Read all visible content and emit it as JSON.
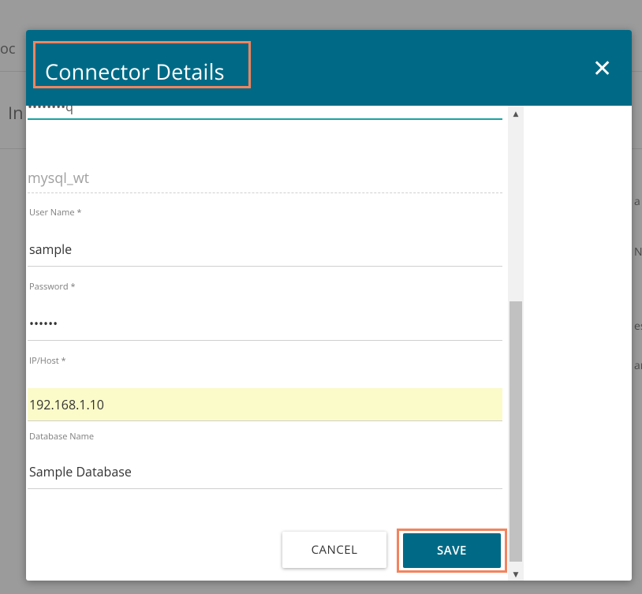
{
  "background": {
    "fragment_1": "oc",
    "fragment_2": "In",
    "fragment_3": "a",
    "fragment_4": "Na",
    "fragment_5": "es",
    "fragment_6": "an"
  },
  "modal": {
    "title": "Connector Details",
    "close_icon": "✕",
    "top_partial_value": "••••••••q",
    "connector_name_value": "mysql_wt",
    "fields": [
      {
        "label": "User Name *",
        "value": "sample"
      },
      {
        "label": "Password *",
        "value": "••••••"
      },
      {
        "label": "IP/Host *",
        "value": "192.168.1.10"
      },
      {
        "label": "Database Name",
        "value": "Sample Database"
      }
    ],
    "buttons": {
      "cancel": "CANCEL",
      "save": "SAVE"
    }
  },
  "colors": {
    "header": "#006a86",
    "highlight": "#f2845e",
    "autofill": "#fbfbc9"
  }
}
